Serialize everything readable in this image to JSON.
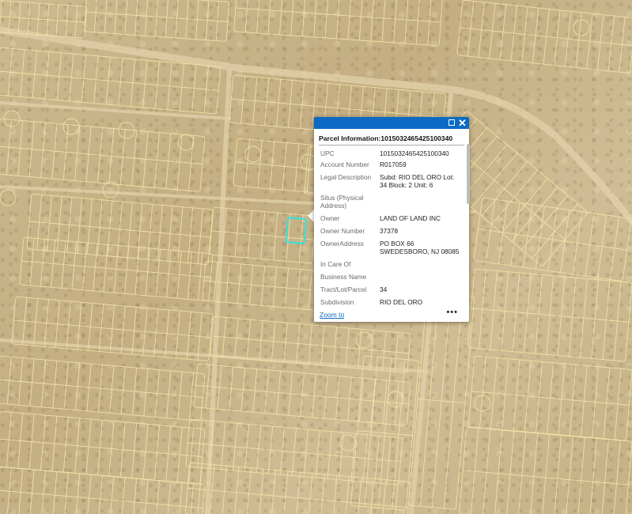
{
  "popup": {
    "title": "Parcel Information:1015032465425100340",
    "fields": [
      {
        "label": "UPC",
        "value": "1015032465425100340"
      },
      {
        "label": "Account Number",
        "value": "R017059"
      },
      {
        "label": "Legal\nDescription",
        "value": "Subd: RIO DEL ORO Lot:\n34 Block: 2 Unit: 6"
      },
      {
        "label": "Situs (Physical\nAddress)",
        "value": ""
      },
      {
        "label": "Owner",
        "value": "LAND OF LAND INC"
      },
      {
        "label": "Owner Number",
        "value": "37378"
      },
      {
        "label": "OwnerAddress",
        "value": "PO BOX 66\nSWEDESBORO, NJ 08085"
      },
      {
        "label": "In Care Of",
        "value": ""
      },
      {
        "label": "Business Name",
        "value": ""
      },
      {
        "label": "Tract/Lot/Parcel",
        "value": "34"
      },
      {
        "label": "Subdivision",
        "value": "RIO DEL ORO"
      }
    ],
    "zoom_label": "Zoom to",
    "more_label": "•••"
  },
  "colors": {
    "header": "#0b6bc4",
    "parcel_lines": "#f4e6a8",
    "selected_parcel": "#2fe4dc"
  }
}
